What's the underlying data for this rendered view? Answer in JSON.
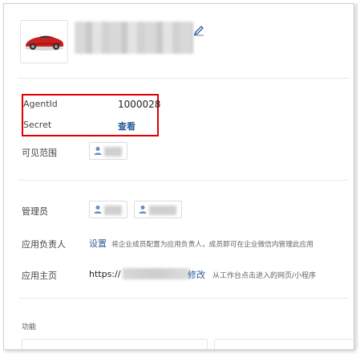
{
  "app": {
    "name_redacted": "",
    "icon": "pencil-icon"
  },
  "credentials": {
    "agentid_label": "AgentId",
    "agentid_value": "1000028",
    "secret_label": "Secret",
    "secret_action": "查看"
  },
  "visibility": {
    "label": "可见范围"
  },
  "admins": {
    "label": "管理员"
  },
  "owner": {
    "label": "应用负责人",
    "action": "设置",
    "hint": "将企业成员配置为应用负责人，成员即可在企业微信内管理此应用"
  },
  "homepage": {
    "label": "应用主页",
    "url_prefix": "https://",
    "action": "修改",
    "hint": "从工作台点击进入的网页/小程序"
  },
  "features": {
    "label": "功能"
  },
  "colors": {
    "link": "#2a5e98",
    "highlight": "#e00000",
    "car_body": "#c81f1f"
  }
}
